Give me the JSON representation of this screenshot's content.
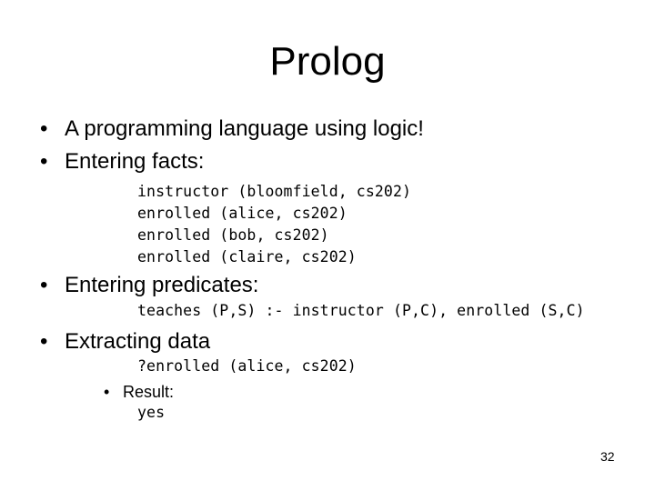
{
  "slide": {
    "title": "Prolog",
    "bullets": [
      {
        "text": "A programming language using logic!"
      },
      {
        "text": "Entering facts:"
      },
      {
        "text": "Entering predicates:"
      },
      {
        "text": "Extracting data"
      }
    ],
    "facts": [
      "instructor (bloomfield, cs202)",
      "enrolled (alice, cs202)",
      "enrolled (bob, cs202)",
      "enrolled (claire, cs202)"
    ],
    "predicate": "teaches (P,S) :- instructor (P,C), enrolled (S,C)",
    "query": "?enrolled (alice, cs202)",
    "result_label": "Result:",
    "result_value": "yes",
    "bullet_glyph": "•",
    "page_number": "32"
  }
}
